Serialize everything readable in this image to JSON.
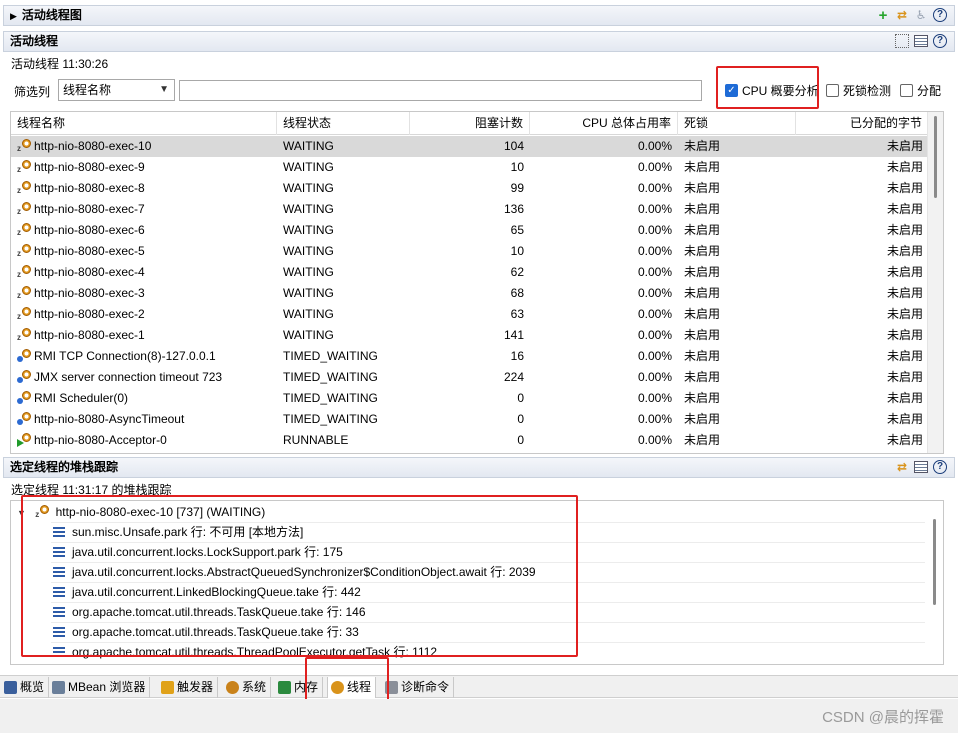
{
  "active_graph_section": {
    "title": "活动线程图"
  },
  "threads_section": {
    "title": "活动线程",
    "timestamp_label": "活动线程 11:30:26"
  },
  "filter": {
    "label": "筛选列",
    "column_value": "线程名称",
    "text_value": ""
  },
  "options": {
    "cpu_profiling": {
      "label": "CPU 概要分析",
      "checked": true
    },
    "deadlock": {
      "label": "死锁检测",
      "checked": false
    },
    "allocation": {
      "label": "分配",
      "checked": false
    }
  },
  "table": {
    "columns": [
      "线程名称",
      "线程状态",
      "阻塞计数",
      "CPU 总体占用率",
      "死锁",
      "已分配的字节"
    ],
    "rows": [
      {
        "icon": "sleeping-thread-icon",
        "name": "http-nio-8080-exec-10",
        "state": "WAITING",
        "blocked": "104",
        "cpu": "0.00%",
        "deadlock": "未启用",
        "alloc": "未启用",
        "selected": true
      },
      {
        "icon": "sleeping-thread-icon",
        "name": "http-nio-8080-exec-9",
        "state": "WAITING",
        "blocked": "10",
        "cpu": "0.00%",
        "deadlock": "未启用",
        "alloc": "未启用"
      },
      {
        "icon": "sleeping-thread-icon",
        "name": "http-nio-8080-exec-8",
        "state": "WAITING",
        "blocked": "99",
        "cpu": "0.00%",
        "deadlock": "未启用",
        "alloc": "未启用"
      },
      {
        "icon": "sleeping-thread-icon",
        "name": "http-nio-8080-exec-7",
        "state": "WAITING",
        "blocked": "136",
        "cpu": "0.00%",
        "deadlock": "未启用",
        "alloc": "未启用"
      },
      {
        "icon": "sleeping-thread-icon",
        "name": "http-nio-8080-exec-6",
        "state": "WAITING",
        "blocked": "65",
        "cpu": "0.00%",
        "deadlock": "未启用",
        "alloc": "未启用"
      },
      {
        "icon": "sleeping-thread-icon",
        "name": "http-nio-8080-exec-5",
        "state": "WAITING",
        "blocked": "10",
        "cpu": "0.00%",
        "deadlock": "未启用",
        "alloc": "未启用"
      },
      {
        "icon": "sleeping-thread-icon",
        "name": "http-nio-8080-exec-4",
        "state": "WAITING",
        "blocked": "62",
        "cpu": "0.00%",
        "deadlock": "未启用",
        "alloc": "未启用"
      },
      {
        "icon": "sleeping-thread-icon",
        "name": "http-nio-8080-exec-3",
        "state": "WAITING",
        "blocked": "68",
        "cpu": "0.00%",
        "deadlock": "未启用",
        "alloc": "未启用"
      },
      {
        "icon": "sleeping-thread-icon",
        "name": "http-nio-8080-exec-2",
        "state": "WAITING",
        "blocked": "63",
        "cpu": "0.00%",
        "deadlock": "未启用",
        "alloc": "未启用"
      },
      {
        "icon": "sleeping-thread-icon",
        "name": "http-nio-8080-exec-1",
        "state": "WAITING",
        "blocked": "141",
        "cpu": "0.00%",
        "deadlock": "未启用",
        "alloc": "未启用"
      },
      {
        "icon": "timed-waiting-thread-icon",
        "name": "RMI TCP Connection(8)-127.0.0.1",
        "state": "TIMED_WAITING",
        "blocked": "16",
        "cpu": "0.00%",
        "deadlock": "未启用",
        "alloc": "未启用"
      },
      {
        "icon": "timed-waiting-thread-icon",
        "name": "JMX server connection timeout 723",
        "state": "TIMED_WAITING",
        "blocked": "224",
        "cpu": "0.00%",
        "deadlock": "未启用",
        "alloc": "未启用"
      },
      {
        "icon": "timed-waiting-thread-icon",
        "name": "RMI Scheduler(0)",
        "state": "TIMED_WAITING",
        "blocked": "0",
        "cpu": "0.00%",
        "deadlock": "未启用",
        "alloc": "未启用"
      },
      {
        "icon": "timed-waiting-thread-icon",
        "name": "http-nio-8080-AsyncTimeout",
        "state": "TIMED_WAITING",
        "blocked": "0",
        "cpu": "0.00%",
        "deadlock": "未启用",
        "alloc": "未启用"
      },
      {
        "icon": "running-thread-icon",
        "name": "http-nio-8080-Acceptor-0",
        "state": "RUNNABLE",
        "blocked": "0",
        "cpu": "0.00%",
        "deadlock": "未启用",
        "alloc": "未启用"
      }
    ]
  },
  "stack_section": {
    "title": "选定线程的堆栈跟踪",
    "timestamp_label": "选定线程 11:31:17 的堆栈跟踪",
    "thread_node": "http-nio-8080-exec-10 [737] (WAITING)",
    "frames": [
      "sun.misc.Unsafe.park 行: 不可用 [本地方法]",
      "java.util.concurrent.locks.LockSupport.park 行: 175",
      "java.util.concurrent.locks.AbstractQueuedSynchronizer$ConditionObject.await 行: 2039",
      "java.util.concurrent.LinkedBlockingQueue.take 行: 442",
      "org.apache.tomcat.util.threads.TaskQueue.take 行: 146",
      "org.apache.tomcat.util.threads.TaskQueue.take 行: 33",
      "org.apache.tomcat.util.threads.ThreadPoolExecutor.getTask 行: 1112"
    ]
  },
  "tabs": [
    {
      "label": "概览",
      "icon": "overview-icon"
    },
    {
      "label": "MBean 浏览器",
      "icon": "mbean-icon"
    },
    {
      "label": "触发器",
      "icon": "trigger-icon"
    },
    {
      "label": "系统",
      "icon": "system-icon"
    },
    {
      "label": "内存",
      "icon": "memory-icon"
    },
    {
      "label": "线程",
      "icon": "threads-icon",
      "active": true
    },
    {
      "label": "诊断命令",
      "icon": "diagnostic-icon"
    }
  ],
  "watermark": "CSDN @晨的挥霍",
  "colors": {
    "highlight_box": "#e02020",
    "selected_row": "#d9d9d9",
    "accent": "#1e6bd6"
  }
}
